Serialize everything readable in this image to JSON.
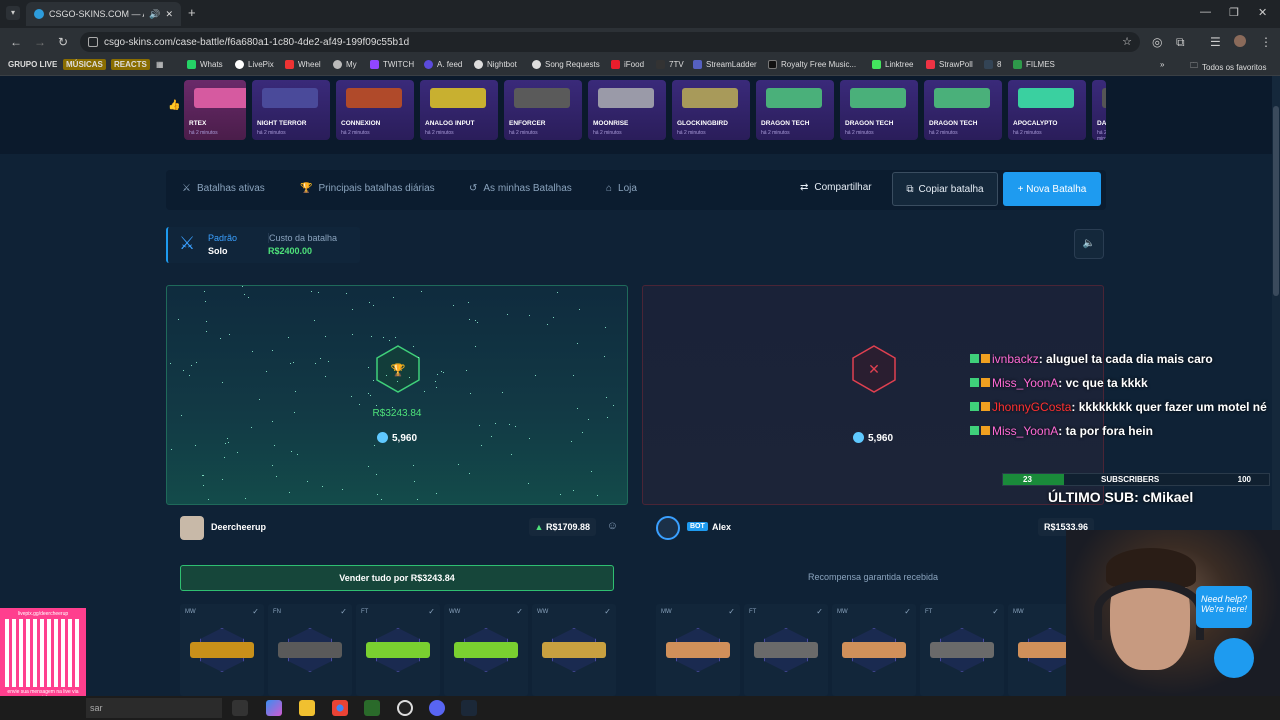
{
  "browser": {
    "tab_title": "CSGO-SKINS.COM — As m",
    "new_tab": "+",
    "url": "csgo-skins.com/case-battle/f6a680a1-1c80-4de2-af49-199f09c55b1d",
    "bookmarks": [
      "GRUPO LIVE",
      "MÚSICAS",
      "REACTS",
      "Whats",
      "LivePix",
      "Wheel",
      "My",
      "TWITCH",
      "A. feed",
      "Nightbot",
      "Song Requests",
      "iFood",
      "7TV",
      "StreamLadder",
      "Royalty Free Music...",
      "Linktree",
      "StrawPoll",
      "8",
      "FILMES"
    ],
    "all_favorites": "Todos os favoritos"
  },
  "drops": [
    {
      "name": "RTEX",
      "time": "há 2 minutos",
      "color": "#d65aa0"
    },
    {
      "name": "NIGHT TERROR",
      "time": "há 2 minutos",
      "color": "#4a4a9a"
    },
    {
      "name": "CONNEXION",
      "time": "há 2 minutos",
      "color": "#b04a2a"
    },
    {
      "name": "ANALOG INPUT",
      "time": "há 2 minutos",
      "color": "#c8b030"
    },
    {
      "name": "ENFORCER",
      "time": "há 2 minutos",
      "color": "#5a5a5a"
    },
    {
      "name": "MOONRISE",
      "time": "há 2 minutos",
      "color": "#9a9aa8"
    },
    {
      "name": "GLOCKINGBIRD",
      "time": "há 2 minutos",
      "color": "#a89a5a"
    },
    {
      "name": "DRAGON TECH",
      "time": "há 2 minutos",
      "color": "#4ab07a"
    },
    {
      "name": "DRAGON TECH",
      "time": "há 2 minutos",
      "color": "#4ab07a"
    },
    {
      "name": "DRAGON TECH",
      "time": "há 2 minutos",
      "color": "#4ab07a"
    },
    {
      "name": "APOCALYPTO",
      "time": "há 2 minutos",
      "color": "#3ad0a0"
    },
    {
      "name": "DAR",
      "time": "há 2 minutos",
      "color": "#555"
    }
  ],
  "nav": {
    "active": "Batalhas ativas",
    "daily": "Principais batalhas diárias",
    "mine": "As minhas Batalhas",
    "shop": "Loja",
    "share": "Compartilhar",
    "copy": "Copiar batalha",
    "new": "+ Nova Batalha"
  },
  "battle": {
    "mode_label": "Padrão",
    "mode_value": "Solo",
    "cost_label": "Custo da batalha",
    "cost_value": "R$2400.00"
  },
  "winner": {
    "amount": "R$3243.84",
    "coins": "5,960",
    "name": "Deercheerup",
    "value": "R$1709.88",
    "sell_button": "Vender tudo por R$3243.84"
  },
  "loser": {
    "coins": "5,960",
    "bot": "BOT",
    "name": "Alex",
    "value": "R$1533.96",
    "reward_text": "Recompensa garantida recebida"
  },
  "items_left": [
    {
      "q": "MW",
      "color": "#c8901a"
    },
    {
      "q": "FN",
      "color": "#5a5a5a"
    },
    {
      "q": "FT",
      "color": "#7ad030"
    },
    {
      "q": "WW",
      "color": "#7ad030"
    },
    {
      "q": "WW",
      "color": "#c8a040"
    }
  ],
  "items_right": [
    {
      "q": "MW",
      "color": "#d0905a"
    },
    {
      "q": "FT",
      "color": "#6a6a6a"
    },
    {
      "q": "MW",
      "color": "#d0905a"
    },
    {
      "q": "FT",
      "color": "#6a6a6a"
    },
    {
      "q": "MW",
      "color": "#d0905a"
    }
  ],
  "chat": [
    {
      "user": "ivnbackz",
      "color": "#ff6ad5",
      "msg": ": aluguel ta cada dia mais caro"
    },
    {
      "user": "Miss_YoonA",
      "color": "#ff6ad5",
      "msg": ": vc que ta kkkk"
    },
    {
      "user": "JhonnyGCosta",
      "color": "#ff3030",
      "msg": ": kkkkkkkk quer fazer um motel né"
    },
    {
      "user": "Miss_YoonA",
      "color": "#ff6ad5",
      "msg": ": ta por fora hein"
    }
  ],
  "subs": {
    "current": "23",
    "label": "SUBSCRIBERS",
    "goal": "100",
    "progress": 0.23,
    "last": "ÚLTIMO SUB: cMikael"
  },
  "help": "Need help? We're here!",
  "qr_text_top": "livepix.gg/deercheerup",
  "qr_text_bottom": "envie sua mensagem na live via pix!",
  "taskbar_search": "sar"
}
